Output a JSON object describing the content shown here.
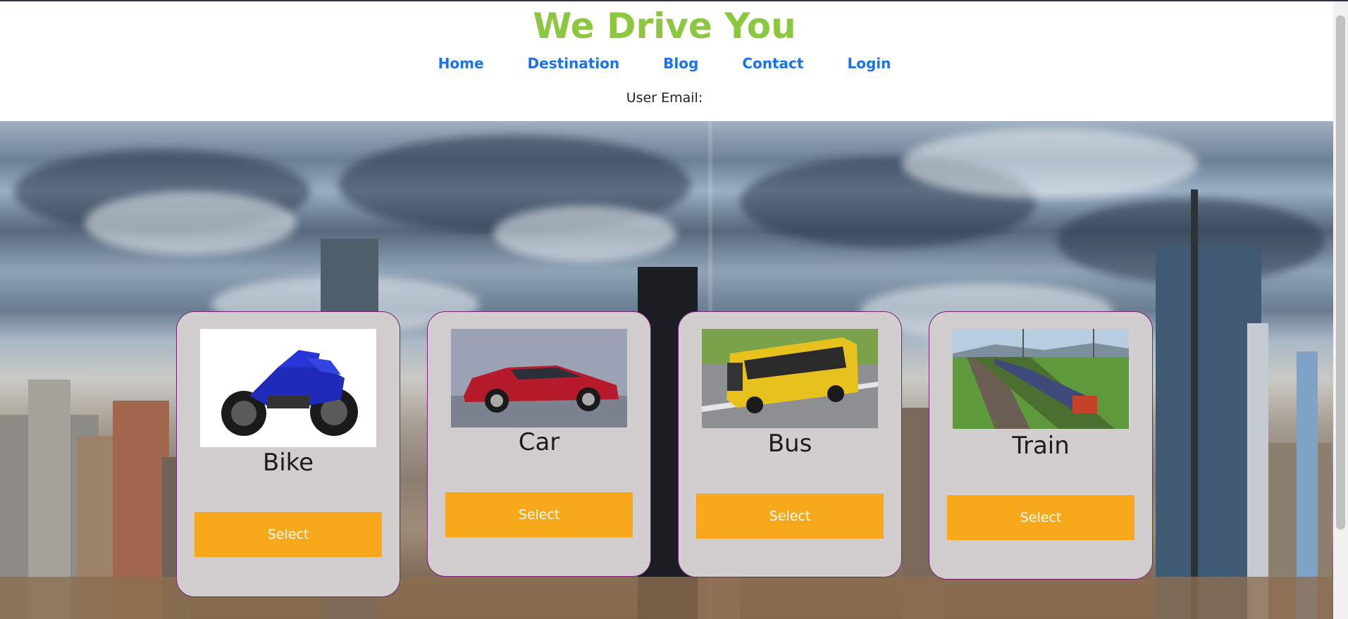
{
  "brand": {
    "title": "We Drive You"
  },
  "nav": [
    {
      "label": "Home"
    },
    {
      "label": "Destination"
    },
    {
      "label": "Blog"
    },
    {
      "label": "Contact"
    },
    {
      "label": "Login"
    }
  ],
  "user": {
    "email_label": "User Email:"
  },
  "vehicles": [
    {
      "name": "Bike",
      "button": "Select"
    },
    {
      "name": "Car",
      "button": "Select"
    },
    {
      "name": "Bus",
      "button": "Select"
    },
    {
      "name": "Train",
      "button": "Select"
    }
  ],
  "colors": {
    "brand": "#8dc63f",
    "nav_link": "#1a73e8",
    "button": "#f7a81b",
    "card_bg": "#d2cdce",
    "card_border": "#7a1f7a"
  }
}
